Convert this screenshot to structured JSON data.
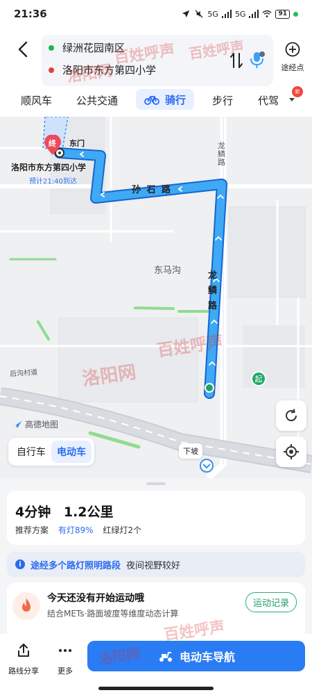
{
  "status_bar": {
    "time": "21:36",
    "network1": "5G",
    "network2": "5G",
    "battery": "91"
  },
  "header": {
    "start_point": "绿洲花园南区",
    "end_point": "洛阳市东方第四小学",
    "waypoint_label": "途经点"
  },
  "tabs": [
    {
      "label": "顺风车"
    },
    {
      "label": "公共交通"
    },
    {
      "label": "骑行"
    },
    {
      "label": "步行"
    },
    {
      "label": "代驾"
    }
  ],
  "new_badge": "新",
  "map": {
    "gate_label": "东门",
    "destination_name": "洛阳市东方第四小学",
    "eta": "预计21:40到达",
    "end_marker": "终",
    "start_marker": "起",
    "road_sunshi": "孙 石 路",
    "road_longlin_vertical": "龙鳞路",
    "road_longlin_small": "龙鳞路",
    "area_dongmagou": "东马沟",
    "village_road": "后沟村道",
    "logo_text": "高德地图",
    "downhill_label": "下坡",
    "vehicle_options": [
      "自行车",
      "电动车"
    ]
  },
  "summary": {
    "duration": "4分钟",
    "distance": "1.2公里",
    "plan_label": "推荐方案",
    "lit_ratio": "有灯89%",
    "traffic_lights": "红绿灯2个"
  },
  "notice": {
    "highlight": "途经多个路灯照明路段",
    "text": "夜间视野较好"
  },
  "exercise": {
    "title": "今天还没有开始运动哦",
    "subtitle": "结合METs·路面坡度等维度动态计算",
    "record_button": "运动记录"
  },
  "bottom_bar": {
    "share_label": "路线分享",
    "more_label": "更多",
    "navigate_label": "电动车导航"
  },
  "watermark": {
    "text1": "百姓呼声",
    "text2": "洛阳网"
  }
}
